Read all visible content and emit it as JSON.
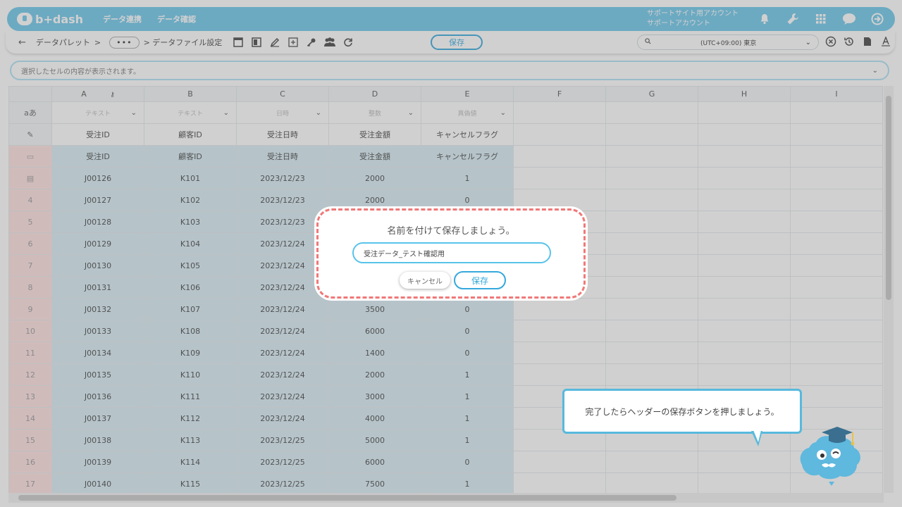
{
  "header": {
    "logo_text": "b+dash",
    "nav": [
      "データ連携",
      "データ確認"
    ],
    "account_line1": "サポートサイト用アカウント",
    "account_line2": "サポートアカウント",
    "icons": [
      "bell-icon",
      "wrench-icon",
      "grid-icon",
      "chat-icon",
      "logout-icon"
    ]
  },
  "toolbar": {
    "crumb_palette": "データパレット",
    "sep": ">",
    "more": "•••",
    "crumb_current": "> データファイル設定",
    "save_label": "保存",
    "timezone": "(UTC+09:00) 東京"
  },
  "cellbar": {
    "placeholder": "選択したセルの内容が表示されます。"
  },
  "sheet": {
    "columns": [
      "A",
      "B",
      "C",
      "D",
      "E",
      "F",
      "G",
      "H",
      "I"
    ],
    "type_row_label": "aあ",
    "type_placeholders": [
      "テキスト",
      "テキスト",
      "日時",
      "整数",
      "真偽値"
    ],
    "headers": [
      "受注ID",
      "顧客ID",
      "受注日時",
      "受注金額",
      "キャンセルフラグ"
    ],
    "rows": [
      {
        "no": "4",
        "cells": [
          "J00127",
          "K102",
          "2023/12/23",
          "2000",
          "0"
        ]
      },
      {
        "no": "5",
        "cells": [
          "J00128",
          "K103",
          "2023/12/23",
          "",
          ""
        ]
      },
      {
        "no": "6",
        "cells": [
          "J00129",
          "K104",
          "2023/12/24",
          "",
          ""
        ]
      },
      {
        "no": "7",
        "cells": [
          "J00130",
          "K105",
          "2023/12/24",
          "",
          ""
        ]
      },
      {
        "no": "8",
        "cells": [
          "J00131",
          "K106",
          "2023/12/24",
          "",
          ""
        ]
      },
      {
        "no": "9",
        "cells": [
          "J00132",
          "K107",
          "2023/12/24",
          "3500",
          "0"
        ]
      },
      {
        "no": "10",
        "cells": [
          "J00133",
          "K108",
          "2023/12/24",
          "6000",
          "0"
        ]
      },
      {
        "no": "11",
        "cells": [
          "J00134",
          "K109",
          "2023/12/24",
          "1400",
          "0"
        ]
      },
      {
        "no": "12",
        "cells": [
          "J00135",
          "K110",
          "2023/12/24",
          "2000",
          "1"
        ]
      },
      {
        "no": "13",
        "cells": [
          "J00136",
          "K111",
          "2023/12/24",
          "3000",
          "1"
        ]
      },
      {
        "no": "14",
        "cells": [
          "J00137",
          "K112",
          "2023/12/24",
          "4000",
          "1"
        ]
      },
      {
        "no": "15",
        "cells": [
          "J00138",
          "K113",
          "2023/12/25",
          "5000",
          "1"
        ]
      },
      {
        "no": "16",
        "cells": [
          "J00139",
          "K114",
          "2023/12/25",
          "6000",
          "0"
        ]
      },
      {
        "no": "17",
        "cells": [
          "J00140",
          "K115",
          "2023/12/25",
          "7500",
          "1"
        ]
      }
    ],
    "first_row": {
      "cells": [
        "J00126",
        "K101",
        "2023/12/23",
        "2000",
        "1"
      ]
    }
  },
  "modal": {
    "title": "名前を付けて保存しましょう。",
    "input_value": "受注データ_テスト確認用",
    "cancel_label": "キャンセル",
    "save_label": "保存"
  },
  "guide": {
    "bubble_text": "完了したらヘッダーの保存ボタンを押しましょう。"
  }
}
